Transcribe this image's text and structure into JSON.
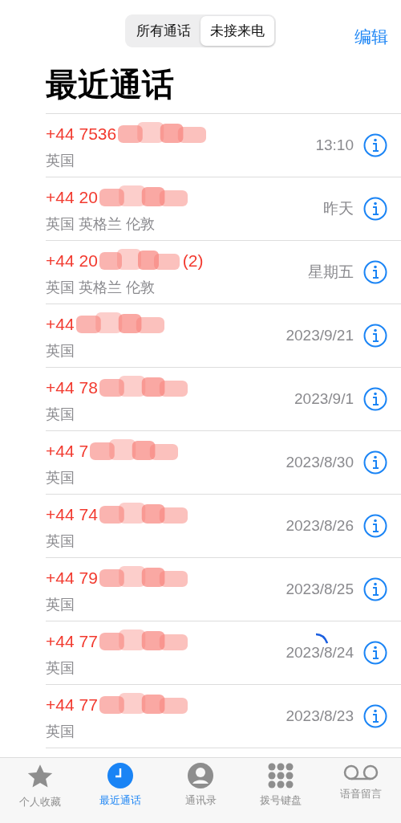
{
  "segments": [
    {
      "label": "所有通话",
      "selected": false
    },
    {
      "label": "未接来电",
      "selected": true
    }
  ],
  "edit": "编辑",
  "title": "最近通话",
  "calls": [
    {
      "number": "+44 7536",
      "location": "英国",
      "time": "13:10",
      "missed": true
    },
    {
      "number": "+44 20",
      "location": "英国 英格兰 伦敦",
      "time": "昨天",
      "missed": true
    },
    {
      "number": "+44 20",
      "count": "(2)",
      "location": "英国 英格兰 伦敦",
      "time": "星期五",
      "missed": true
    },
    {
      "number": "+44",
      "location": "英国",
      "time": "2023/9/21",
      "missed": true
    },
    {
      "number": "+44 78",
      "location": "英国",
      "time": "2023/9/1",
      "missed": true
    },
    {
      "number": "+44 7",
      "location": "英国",
      "time": "2023/8/30",
      "missed": true
    },
    {
      "number": "+44 74",
      "location": "英国",
      "time": "2023/8/26",
      "missed": true
    },
    {
      "number": "+44 79",
      "location": "英国",
      "time": "2023/8/25",
      "missed": true
    },
    {
      "number": "+44 77",
      "location": "英国",
      "time": "2023/8/24",
      "missed": true
    },
    {
      "number": "+44 77",
      "location": "英国",
      "time": "2023/8/23",
      "missed": true
    }
  ],
  "tabs": [
    {
      "kind": "star",
      "label": "个人收藏",
      "selected": false
    },
    {
      "kind": "clock",
      "label": "最近通话",
      "selected": true
    },
    {
      "kind": "person",
      "label": "通讯录",
      "selected": false
    },
    {
      "kind": "keypad",
      "label": "拨号键盘",
      "selected": false
    },
    {
      "kind": "voicemail",
      "label": "语音留言",
      "selected": false
    }
  ]
}
